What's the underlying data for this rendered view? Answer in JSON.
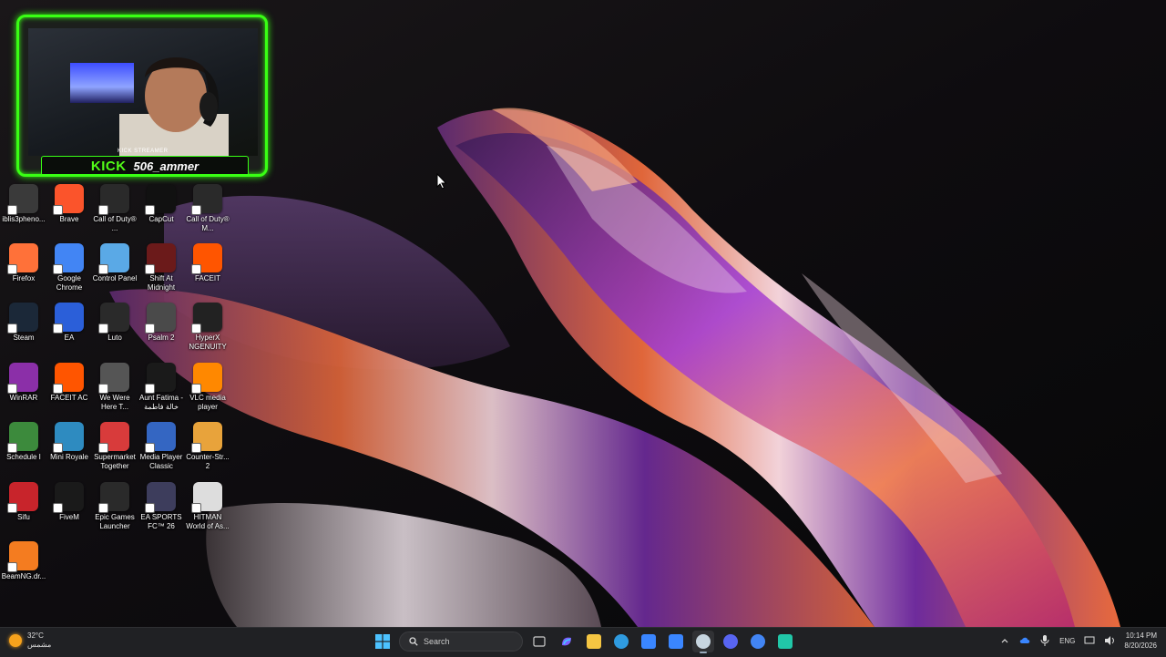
{
  "streamer_overlay": {
    "platform": "KICK",
    "subtitle": "KICK STREAMER",
    "username": "506_ammer"
  },
  "desktop_icons": [
    {
      "name": "iblis3pheno...",
      "icon": "app-icon",
      "color": "#3a3a3a"
    },
    {
      "name": "Brave",
      "icon": "brave-icon",
      "color": "#fb542b"
    },
    {
      "name": "Call of Duty® ...",
      "icon": "call-of-duty-icon",
      "color": "#2a2a2a"
    },
    {
      "name": "CapCut",
      "icon": "capcut-icon",
      "color": "#111111"
    },
    {
      "name": "Call of Duty® M...",
      "icon": "call-of-duty-mw-icon",
      "color": "#2a2a2a"
    },
    {
      "name": "Firefox",
      "icon": "firefox-icon",
      "color": "#ff7139"
    },
    {
      "name": "Google Chrome",
      "icon": "chrome-icon",
      "color": "#4285f4"
    },
    {
      "name": "Control Panel",
      "icon": "control-panel-icon",
      "color": "#5aa9e6"
    },
    {
      "name": "Shift At Midnight",
      "icon": "shift-at-midnight-icon",
      "color": "#6b1a1a"
    },
    {
      "name": "FACEIT",
      "icon": "faceit-icon",
      "color": "#ff5500"
    },
    {
      "name": "Steam",
      "icon": "steam-icon",
      "color": "#1b2838"
    },
    {
      "name": "EA",
      "icon": "ea-icon",
      "color": "#2b5fd9"
    },
    {
      "name": "Luto",
      "icon": "epic-games-icon",
      "color": "#2a2a2a"
    },
    {
      "name": "Psalm 2",
      "icon": "psalm-icon",
      "color": "#4a4a4a"
    },
    {
      "name": "HyperX NGENUITY",
      "icon": "hyperx-icon",
      "color": "#222222"
    },
    {
      "name": "WinRAR",
      "icon": "winrar-icon",
      "color": "#8b2fa8"
    },
    {
      "name": "FACEIT AC",
      "icon": "faceit-ac-icon",
      "color": "#ff5500"
    },
    {
      "name": "We Were Here T...",
      "icon": "we-were-here-icon",
      "color": "#555555"
    },
    {
      "name": "Aunt Fatima - خالة فاطمة",
      "icon": "aunt-fatima-icon",
      "color": "#1a1a1a"
    },
    {
      "name": "VLC media player",
      "icon": "vlc-icon",
      "color": "#ff8800"
    },
    {
      "name": "Schedule I",
      "icon": "schedule-icon",
      "color": "#3c8a3c"
    },
    {
      "name": "Mini Royale",
      "icon": "mini-royale-icon",
      "color": "#2e8bc0"
    },
    {
      "name": "Supermarket Together",
      "icon": "supermarket-icon",
      "color": "#d83b3b"
    },
    {
      "name": "Media Player Classic",
      "icon": "media-player-icon",
      "color": "#3466c2"
    },
    {
      "name": "Counter-Str... 2",
      "icon": "counter-strike-icon",
      "color": "#e8a33b"
    },
    {
      "name": "Sifu",
      "icon": "sifu-icon",
      "color": "#c8242b"
    },
    {
      "name": "FiveM",
      "icon": "fivem-icon",
      "color": "#1a1a1a"
    },
    {
      "name": "Epic Games Launcher",
      "icon": "epic-games-launcher-icon",
      "color": "#2a2a2a"
    },
    {
      "name": "EA SPORTS FC™ 26",
      "icon": "ea-sports-fc-icon",
      "color": "#3d3d5c"
    },
    {
      "name": "HITMAN World of As...",
      "icon": "hitman-icon",
      "color": "#dddddd"
    },
    {
      "name": "BeamNG.dr...",
      "icon": "beamng-icon",
      "color": "#f47c20"
    }
  ],
  "taskbar": {
    "weather_temp": "32°C",
    "weather_desc": "مشمس",
    "search_placeholder": "Search",
    "apps": [
      {
        "name": "file-explorer",
        "icon": "folder-icon",
        "color": "#f4c542"
      },
      {
        "name": "edge",
        "icon": "edge-icon",
        "color": "#2f9be0"
      },
      {
        "name": "store",
        "icon": "store-icon",
        "color": "#3a86ff"
      },
      {
        "name": "mail",
        "icon": "mail-icon",
        "color": "#3a86ff"
      },
      {
        "name": "steam",
        "icon": "steam-icon",
        "color": "#c7d5e0",
        "active": true
      },
      {
        "name": "discord",
        "icon": "discord-icon",
        "color": "#5865f2"
      },
      {
        "name": "chrome",
        "icon": "chrome-icon",
        "color": "#4285f4"
      },
      {
        "name": "app",
        "icon": "app-icon",
        "color": "#21c7a8"
      }
    ],
    "language": "ENG",
    "time": "10:14 PM",
    "date": "8/20/2026"
  }
}
